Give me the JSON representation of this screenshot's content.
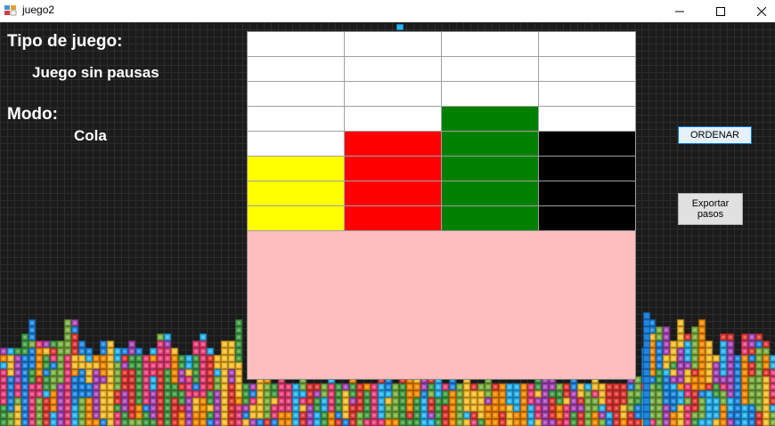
{
  "window": {
    "title": "juego2",
    "icon": "tetris-app-icon"
  },
  "labels": {
    "tipo_title": "Tipo de juego:",
    "tipo_value": "Juego sin pausas",
    "modo_title": "Modo:",
    "modo_value": "Cola"
  },
  "buttons": {
    "ordenar": "ORDENAR",
    "exportar": "Exportar pasos"
  },
  "board": {
    "columns": 4,
    "rows": 8,
    "cells": [
      [
        "#ffffff",
        "#ffffff",
        "#ffffff",
        "#ffffff"
      ],
      [
        "#ffffff",
        "#ffffff",
        "#ffffff",
        "#ffffff"
      ],
      [
        "#ffffff",
        "#ffffff",
        "#ffffff",
        "#ffffff"
      ],
      [
        "#ffffff",
        "#ffffff",
        "#008000",
        "#ffffff"
      ],
      [
        "#ffffff",
        "#ff0000",
        "#008000",
        "#000000"
      ],
      [
        "#ffff00",
        "#ff0000",
        "#008000",
        "#000000"
      ],
      [
        "#ffff00",
        "#ff0000",
        "#008000",
        "#000000"
      ],
      [
        "#ffff00",
        "#ff0000",
        "#008000",
        "#000000"
      ]
    ],
    "background_color": "#ffbebe"
  },
  "colors": {
    "bricks": [
      "#e53935",
      "#fbc02d",
      "#43a047",
      "#1e88e5",
      "#29b6f6",
      "#ab47bc",
      "#fb8c00",
      "#ec407a",
      "#7cb342"
    ]
  }
}
